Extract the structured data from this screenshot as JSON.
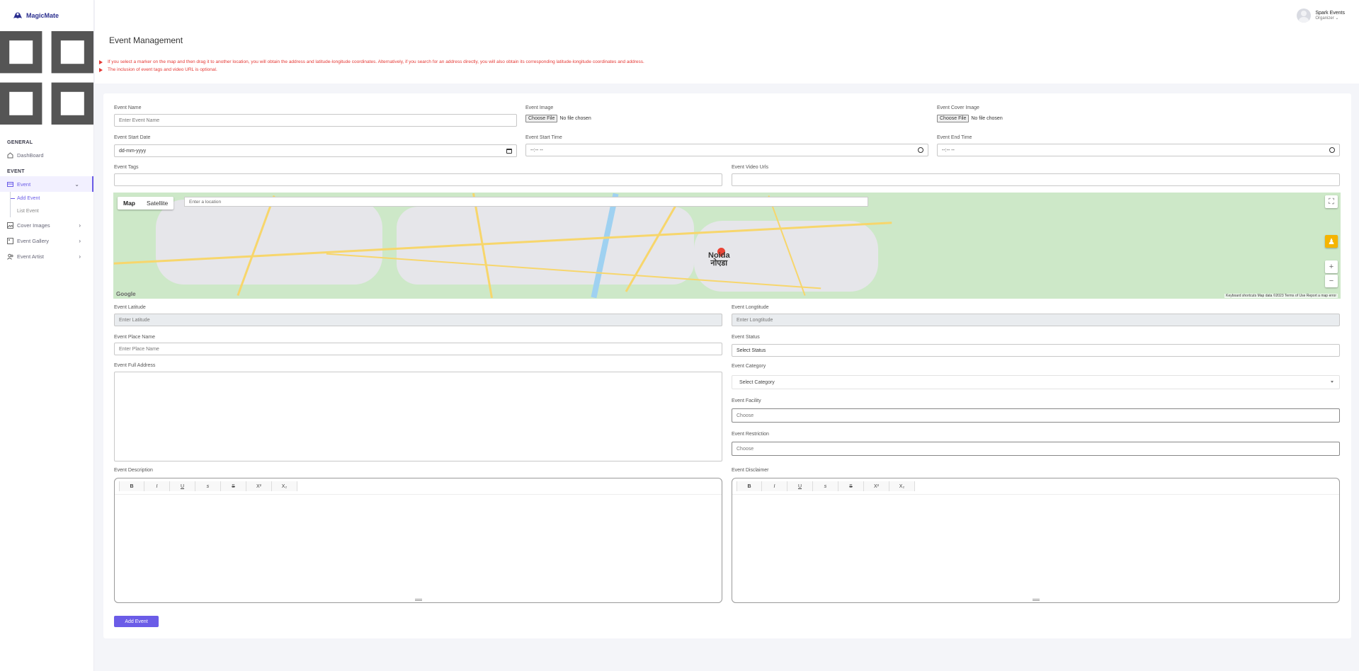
{
  "brand": {
    "name": "MagicMate"
  },
  "sidebar": {
    "sections": [
      {
        "title": "GENERAL"
      },
      {
        "title": "EVENT"
      }
    ],
    "items": {
      "dashboard": "DashBoard",
      "event": "Event",
      "add_event": "Add Event",
      "list_event": "List Event",
      "cover_images": "Cover Images",
      "event_gallery": "Event Gallery",
      "event_artist": "Event Artist"
    }
  },
  "user": {
    "name": "Spark Events",
    "role": "Organizer"
  },
  "page": {
    "title": "Event Management",
    "notes": [
      "If you select a marker on the map and then drag it to another location, you will obtain the address and latitude-longitude coordinates. Alternatively, if you search for an address directly, you will also obtain its corresponding latitude-longitude coordinates and address.",
      "The inclusion of event tags and video URL is optional."
    ]
  },
  "form": {
    "event_name": {
      "label": "Event Name",
      "placeholder": "Enter Event Name"
    },
    "event_image": {
      "label": "Event Image",
      "button": "Choose File",
      "status": "No file chosen"
    },
    "event_cover_image": {
      "label": "Event Cover Image",
      "button": "Choose File",
      "status": "No file chosen"
    },
    "start_date": {
      "label": "Event Start Date",
      "value": "dd-mm-yyyy"
    },
    "start_time": {
      "label": "Event Start Time",
      "value": "--:-- --"
    },
    "end_time": {
      "label": "Event End Time",
      "value": "--:-- --"
    },
    "tags": {
      "label": "Event Tags"
    },
    "video_urls": {
      "label": "Event Video Urls"
    },
    "map": {
      "type_map": "Map",
      "type_satellite": "Satellite",
      "search_placeholder": "Enter a location",
      "city_label_1": "Noida",
      "city_label_2": "नोएडा",
      "google": "Google",
      "footer": "Keyboard shortcuts   Map data ©2023   Terms of Use   Report a map error"
    },
    "latitude": {
      "label": "Event Latitude",
      "placeholder": "Enter Latitude"
    },
    "longitude": {
      "label": "Event Longtitude",
      "placeholder": "Enter Longtitude"
    },
    "place_name": {
      "label": "Event Place Name",
      "placeholder": "Enter Place Name"
    },
    "status": {
      "label": "Event Status",
      "value": "Select Status"
    },
    "full_address": {
      "label": "Event Full Address"
    },
    "category": {
      "label": "Event Category",
      "value": "Select Category"
    },
    "facility": {
      "label": "Event Facility",
      "placeholder": "Choose"
    },
    "restriction": {
      "label": "Event Restriction",
      "placeholder": "Choose"
    },
    "description": {
      "label": "Event Description"
    },
    "disclaimer": {
      "label": "Event Disclaimer"
    },
    "toolbar": [
      "B",
      "I",
      "U",
      "𝘴",
      "S",
      "X²",
      "X₂"
    ],
    "submit": "Add Event"
  },
  "colors": {
    "accent": "#6b5ce7",
    "warning": "#e53935"
  }
}
